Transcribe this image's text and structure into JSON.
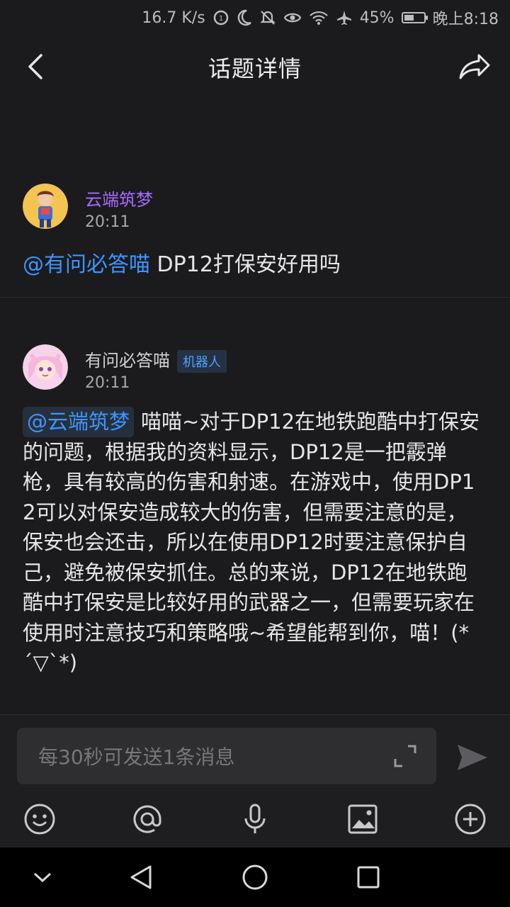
{
  "status_bar": {
    "speed": "16.7 K/s",
    "battery": "45%",
    "time": "晚上8:18",
    "icons": [
      "data-saver-icon",
      "moon-icon",
      "mute-icon",
      "eye-icon",
      "wifi-icon",
      "airplane-icon",
      "battery-icon"
    ],
    "battery_level": 0.45
  },
  "header": {
    "title": "话题详情",
    "back_icon": "back-arrow-icon",
    "share_icon": "share-icon"
  },
  "question": {
    "author": "云端筑梦",
    "author_color": "#a86bff",
    "time": "20:11",
    "mention": "@有问必答喵",
    "text": " DP12打保安好用吗"
  },
  "answer": {
    "author": "有问必答喵",
    "badge": "机器人",
    "time": "20:11",
    "mention": "@云端筑梦",
    "text": "喵喵~对于DP12在地铁跑酷中打保安的问题，根据我的资料显示，DP12是一把霰弹枪，具有较高的伤害和射速。在游戏中，使用DP12可以对保安造成较大的伤害，但需要注意的是，保安也会还击，所以在使用DP12时要注意保护自己，避免被保安抓住。总的来说，DP12在地铁跑酷中打保安是比较好用的武器之一，但需要玩家在使用时注意技巧和策略哦~希望能帮到你，喵！(*´▽`*)"
  },
  "composer": {
    "placeholder": "每30秒可发送1条消息",
    "toolbar_icons": [
      "emoji-icon",
      "at-icon",
      "microphone-icon",
      "image-icon",
      "plus-icon"
    ]
  },
  "colors": {
    "background": "#1b1b1d",
    "accent": "#3d95ff",
    "author_purple": "#a86bff"
  }
}
